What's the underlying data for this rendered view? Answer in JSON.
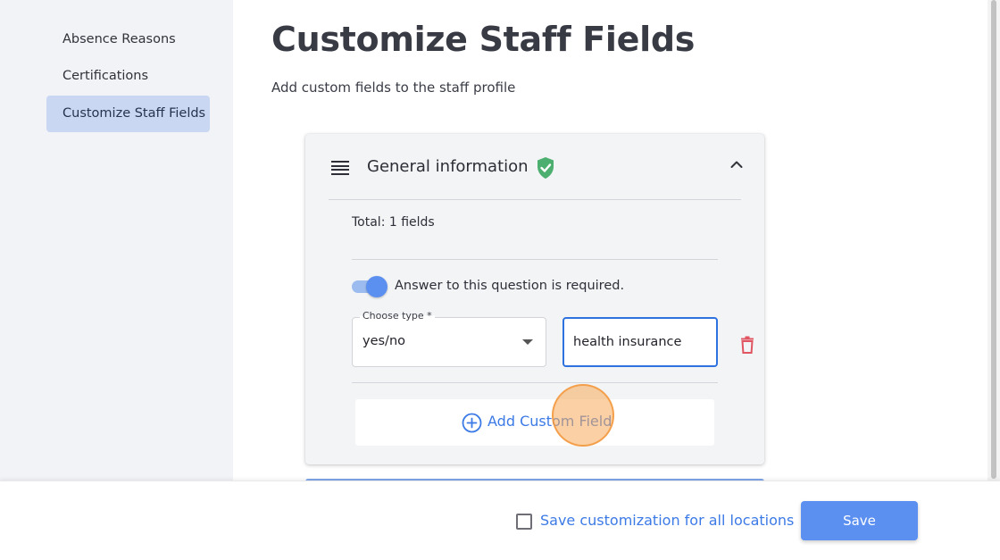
{
  "sidebar": {
    "items": [
      {
        "label": "Absence Reasons"
      },
      {
        "label": "Certifications"
      },
      {
        "label": "Customize Staff Fields",
        "active": true
      }
    ]
  },
  "main": {
    "title": "Customize Staff Fields",
    "subtitle": "Add custom fields to the staff profile"
  },
  "card": {
    "title": "General information",
    "total": "Total: 1 fields",
    "required_toggle": {
      "label": "Answer to this question is required.",
      "on": true
    },
    "field": {
      "type_label": "Choose type *",
      "type_value": "yes/no",
      "name_value": "health insurance"
    },
    "add_field_label": "Add Custom Field"
  },
  "footer": {
    "checkbox_label": "Save customization for all locations",
    "checkbox_checked": false,
    "save_label": "Save"
  },
  "icons": {
    "drag": "drag-handle-icon",
    "verified": "shield-check-icon",
    "collapse": "chevron-up-icon",
    "delete": "trash-icon",
    "add": "plus-circle-icon"
  },
  "colors": {
    "accent": "#5b8ff0",
    "link": "#3c7ae6",
    "active_nav": "#c9d7f3",
    "verified": "#4caf70",
    "delete": "#e05561"
  }
}
